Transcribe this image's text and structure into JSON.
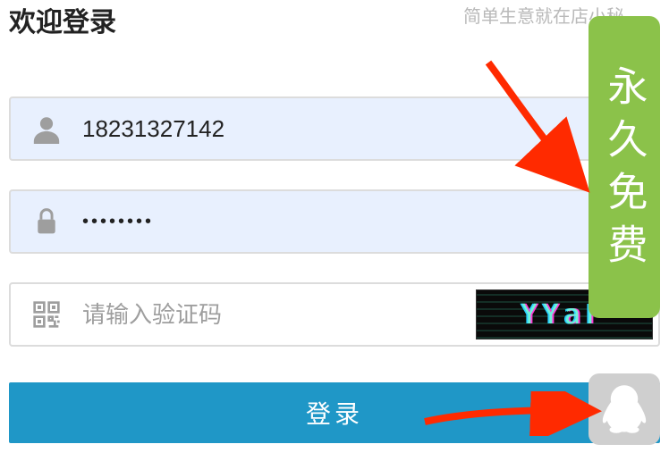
{
  "header": {
    "title": "欢迎登录",
    "subtitle": "简单生意就在店小秘"
  },
  "form": {
    "username_value": "18231327142",
    "password_value": "••••••••",
    "captcha_placeholder": "请输入验证码",
    "captcha_text": "YYaF",
    "login_label": "登录"
  },
  "banner": {
    "text": "永久免费"
  },
  "icons": {
    "user": "user-icon",
    "lock": "lock-icon",
    "qr": "qr-icon",
    "qq": "qq-icon"
  }
}
